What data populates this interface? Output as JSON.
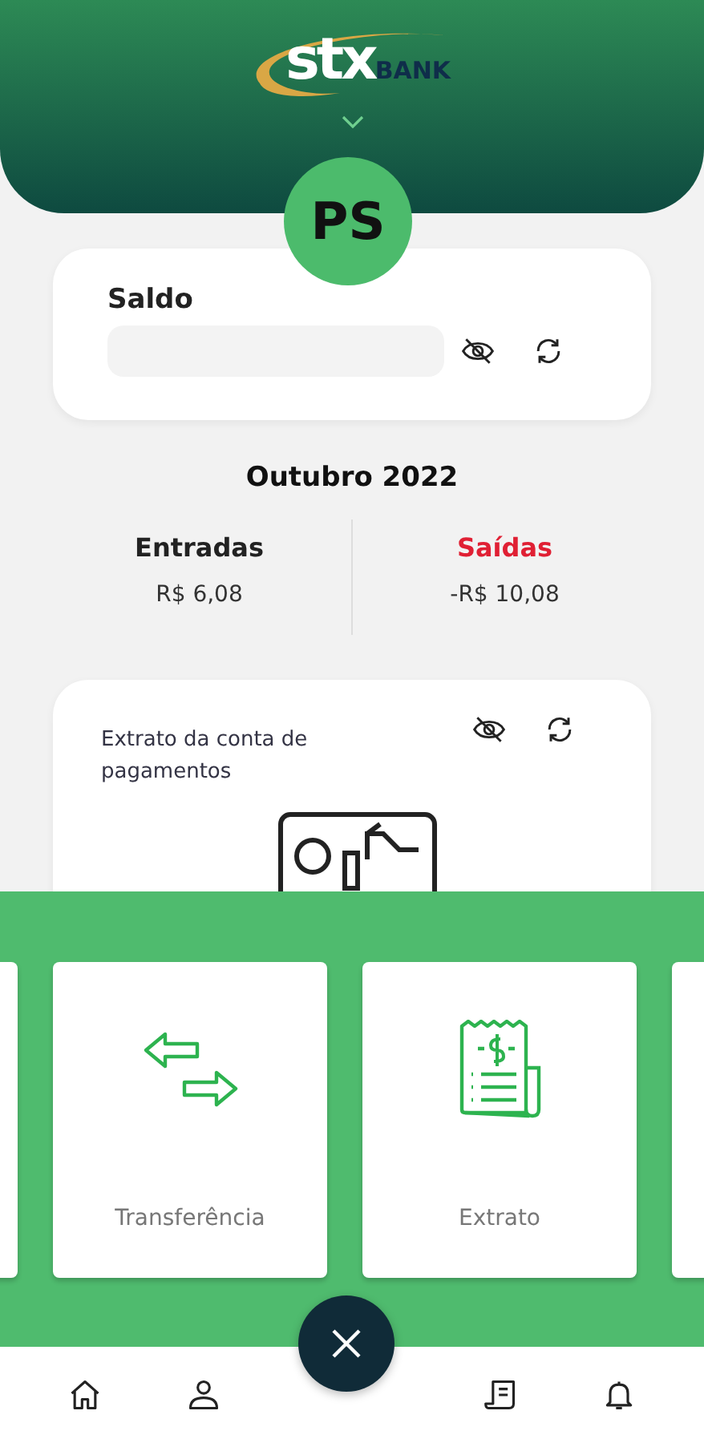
{
  "header": {
    "logo_main": "stx",
    "logo_sub": "BANK"
  },
  "avatar": {
    "initials": "PS"
  },
  "balance": {
    "label": "Saldo"
  },
  "period": "Outubro 2022",
  "summary": [
    {
      "kind": "in",
      "label": "Entradas",
      "value": "R$ 6,08"
    },
    {
      "kind": "out",
      "label": "Saídas",
      "value": "-R$ 10,08"
    }
  ],
  "statement_card": {
    "title": "Extrato da conta de pagamentos"
  },
  "shortcuts": [
    {
      "kind": "transfer",
      "label": "Transferência"
    },
    {
      "kind": "statement",
      "label": "Extrato"
    }
  ],
  "bottom_nav": [
    {
      "kind": "home"
    },
    {
      "kind": "profile"
    },
    {
      "kind": "statement"
    },
    {
      "kind": "notifications"
    }
  ]
}
